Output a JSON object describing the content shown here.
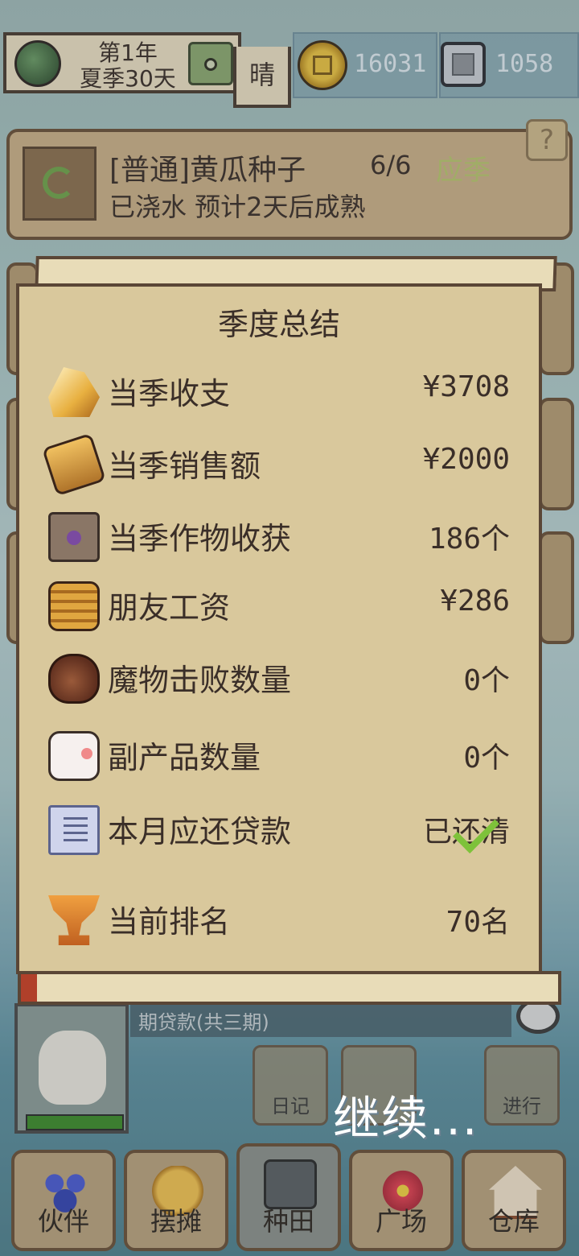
{
  "top_bar": {
    "year": "第1年",
    "season_day": "夏季30天",
    "weather": "晴",
    "coins": "16031",
    "gems": "1058"
  },
  "crop": {
    "title": "[普通]黄瓜种子",
    "count": "6/6",
    "season_tag": "应季",
    "status": "已浇水 预计2天后成熟",
    "help": "?"
  },
  "summary": {
    "title": "季度总结",
    "rows": [
      {
        "label": "当季收支",
        "value": "¥3708",
        "icon": "crystal-icon"
      },
      {
        "label": "当季销售额",
        "value": "¥2000",
        "icon": "bread-icon"
      },
      {
        "label": "当季作物收获",
        "value": "186个",
        "icon": "seed-box-icon"
      },
      {
        "label": "朋友工资",
        "value": "¥286",
        "icon": "basket-icon"
      },
      {
        "label": "魔物击败数量",
        "value": "0个",
        "icon": "bag-icon"
      },
      {
        "label": "副产品数量",
        "value": "0个",
        "icon": "egg-icon"
      },
      {
        "label": "本月应还贷款",
        "value": "已还清",
        "icon": "document-icon"
      },
      {
        "label": "当前排名",
        "value": "70名",
        "icon": "trophy-icon"
      }
    ]
  },
  "loan_text": "期贷款(共三期)",
  "actions": {
    "diary": "日记",
    "proceed": "进行"
  },
  "continue_text": "继续...",
  "nav": [
    {
      "label": "伙伴",
      "icon": "people-icon"
    },
    {
      "label": "摆摊",
      "icon": "stall-icon"
    },
    {
      "label": "种田",
      "icon": "watering-can-icon"
    },
    {
      "label": "广场",
      "icon": "flower-icon"
    },
    {
      "label": "仓库",
      "icon": "house-icon"
    }
  ],
  "colors": {
    "panel": "#d9c89c",
    "border": "#5a4636",
    "accent_green": "#7ec23a",
    "season_tag": "#b6c46c"
  }
}
